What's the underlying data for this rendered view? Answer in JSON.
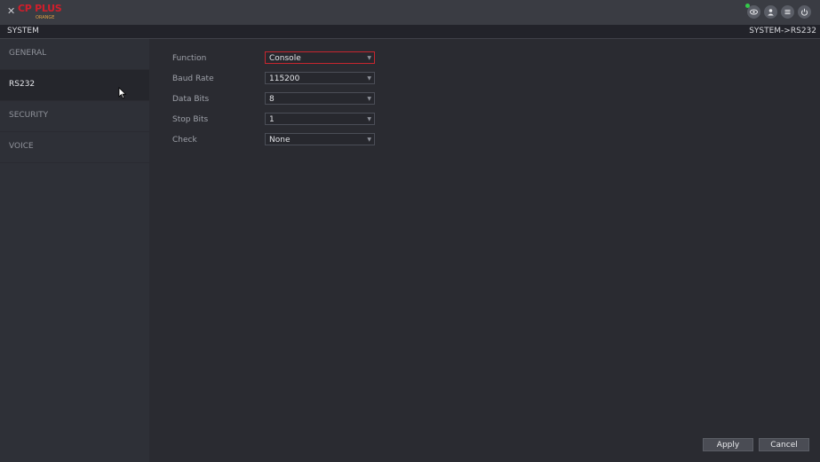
{
  "header": {
    "logo_brand": "CP PLUS",
    "logo_sub": "ORANGE",
    "icons": [
      "monitor-icon",
      "user-icon",
      "menu-icon",
      "power-icon"
    ]
  },
  "titlebar": {
    "title": "SYSTEM",
    "breadcrumb": "SYSTEM->RS232"
  },
  "sidebar": {
    "items": [
      {
        "label": "GENERAL",
        "active": false
      },
      {
        "label": "RS232",
        "active": true
      },
      {
        "label": "SECURITY",
        "active": false
      },
      {
        "label": "VOICE",
        "active": false
      }
    ]
  },
  "form": {
    "fields": [
      {
        "label": "Function",
        "value": "Console"
      },
      {
        "label": "Baud Rate",
        "value": "115200"
      },
      {
        "label": "Data Bits",
        "value": "8"
      },
      {
        "label": "Stop Bits",
        "value": "1"
      },
      {
        "label": "Check",
        "value": "None"
      }
    ]
  },
  "buttons": {
    "apply": "Apply",
    "cancel": "Cancel"
  },
  "colors": {
    "accent_red": "#c7262f",
    "background": "#2a2b31",
    "status_green": "#34c94a"
  }
}
